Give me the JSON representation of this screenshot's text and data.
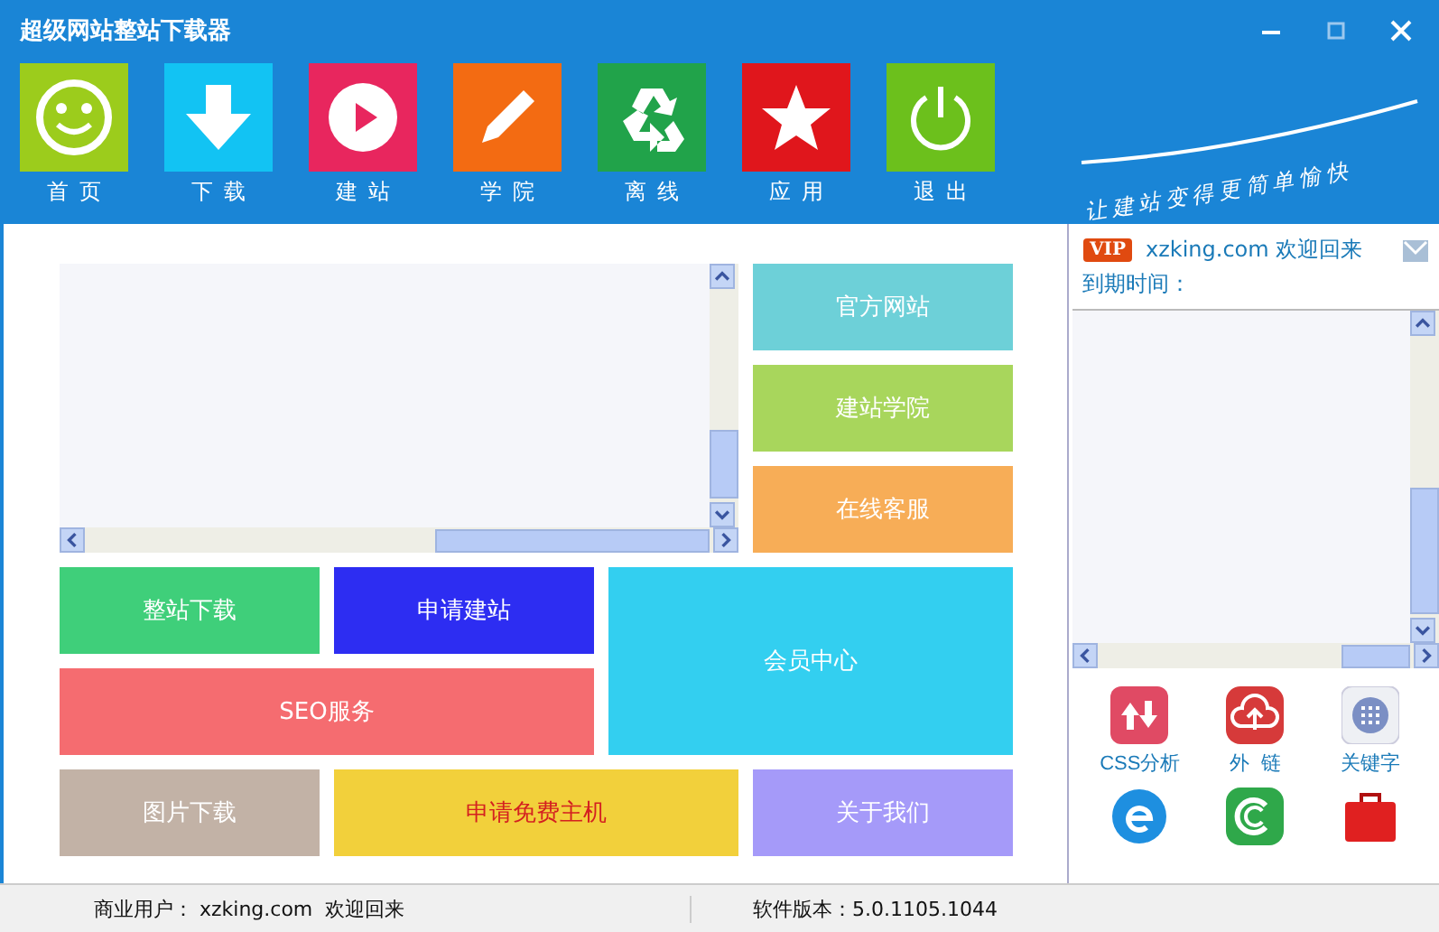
{
  "window": {
    "title": "超级网站整站下载器",
    "slogan": "让建站变得更简单愉快"
  },
  "toolbar": [
    {
      "label": "首页",
      "color": "#9ccc1c"
    },
    {
      "label": "下载",
      "color": "#12c3f3"
    },
    {
      "label": "建站",
      "color": "#e8265e"
    },
    {
      "label": "学院",
      "color": "#f36b12"
    },
    {
      "label": "离线",
      "color": "#21a34a"
    },
    {
      "label": "应用",
      "color": "#e0161c"
    },
    {
      "label": "退出",
      "color": "#6cc01c"
    }
  ],
  "tiles": [
    {
      "label": "官方网站",
      "color": "#6dd0d8"
    },
    {
      "label": "建站学院",
      "color": "#a8d65c"
    },
    {
      "label": "在线客服",
      "color": "#f7ad57"
    },
    {
      "label": "整站下载",
      "color": "#3fcf7a"
    },
    {
      "label": "申请建站",
      "color": "#2d2df2"
    },
    {
      "label": "会员中心",
      "color": "#33cff0"
    },
    {
      "label": "SEO服务",
      "color": "#f56c70"
    },
    {
      "label": "图片下载",
      "color": "#c2b2a6"
    },
    {
      "label": "申请免费主机",
      "color": "#f2d03b"
    },
    {
      "label": "关于我们",
      "color": "#a59af9"
    }
  ],
  "user": {
    "badge": "VIP",
    "greeting": "xzking.com 欢迎回来",
    "expiry_label": "到期时间："
  },
  "apps": [
    {
      "label": "CSS分析"
    },
    {
      "label": "外  链"
    },
    {
      "label": "关键字"
    }
  ],
  "status_bar": {
    "user": "商业用户： xzking.com  欢迎回来",
    "version": "软件版本：5.0.1105.1044"
  }
}
